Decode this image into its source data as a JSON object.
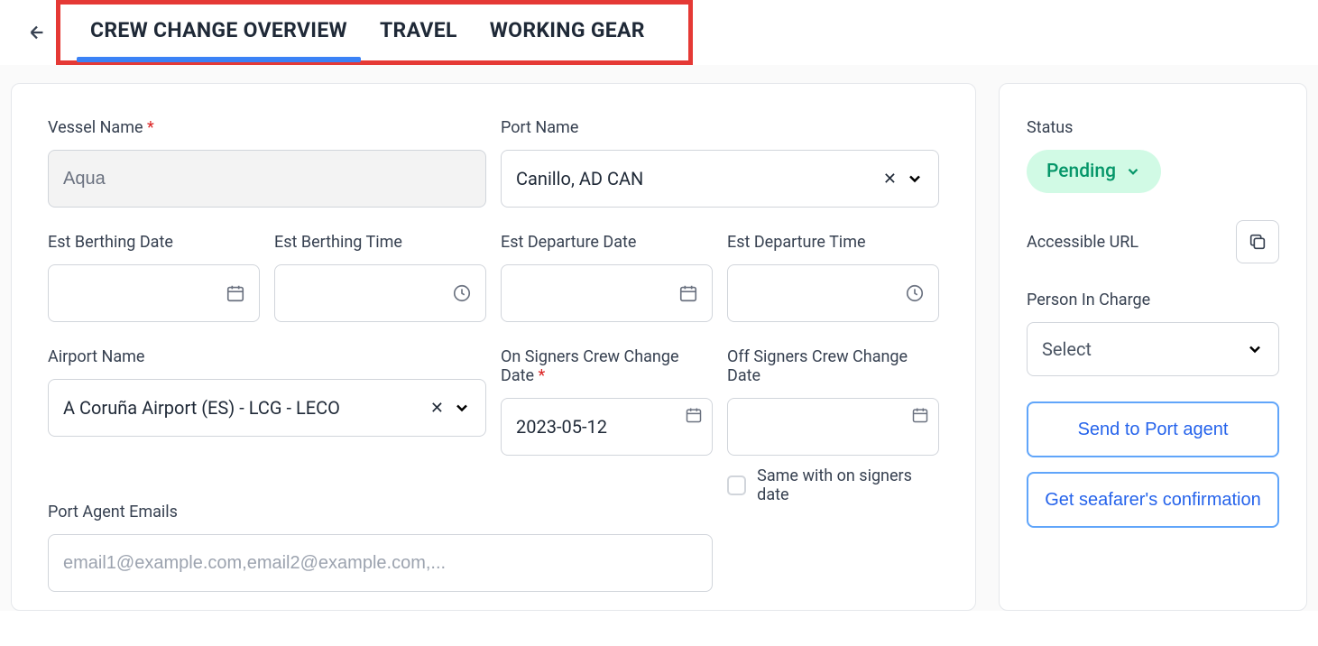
{
  "tabs": {
    "overview": "CREW CHANGE OVERVIEW",
    "travel": "TRAVEL",
    "gear": "WORKING GEAR"
  },
  "form": {
    "vessel_name_label": "Vessel Name",
    "vessel_name_value": "Aqua",
    "port_name_label": "Port Name",
    "port_name_value": "Canillo, AD CAN",
    "est_berthing_date_label": "Est Berthing Date",
    "est_berthing_time_label": "Est Berthing Time",
    "est_departure_date_label": "Est Departure Date",
    "est_departure_time_label": "Est Departure Time",
    "airport_name_label": "Airport Name",
    "airport_name_value": "A Coruña Airport (ES) - LCG - LECO",
    "on_signers_date_label": "On Signers Crew Change Date",
    "on_signers_date_value": "2023-05-12",
    "off_signers_date_label": "Off Signers Crew Change Date",
    "same_date_label": "Same with on signers date",
    "port_agent_label": "Port Agent Emails",
    "port_agent_placeholder": "email1@example.com,email2@example.com,..."
  },
  "sidebar": {
    "status_label": "Status",
    "status_value": "Pending",
    "accessible_url_label": "Accessible URL",
    "person_in_charge_label": "Person In Charge",
    "person_in_charge_placeholder": "Select",
    "send_port_agent": "Send to Port agent",
    "get_confirmation": "Get seafarer's confirmation"
  }
}
